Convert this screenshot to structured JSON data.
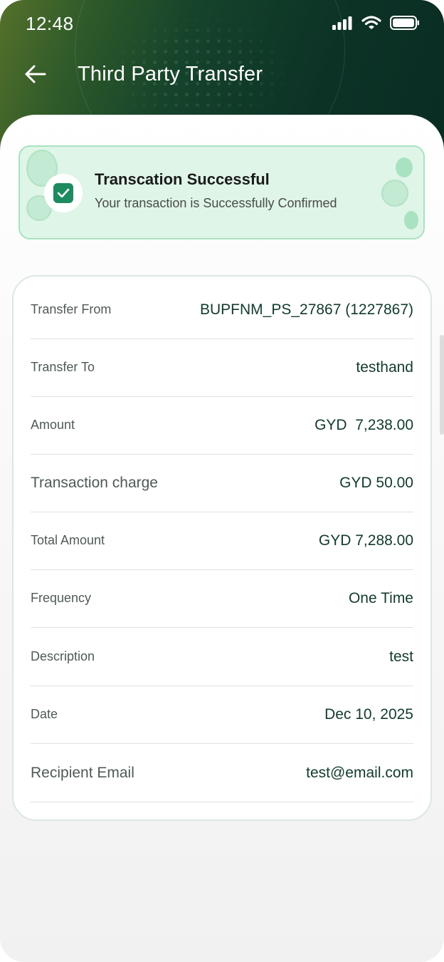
{
  "status_bar": {
    "time": "12:48",
    "icons": [
      "signal-icon",
      "wifi-icon",
      "battery-icon"
    ]
  },
  "nav": {
    "back_icon": "arrow-left-icon",
    "title": "Third Party Transfer"
  },
  "banner": {
    "title": "Transcation Successful",
    "subtitle": "Your transaction is Successfully Confirmed",
    "icon": "checkbox-checked-icon"
  },
  "details": [
    {
      "label": "Transfer From",
      "value": "BUPFNM_PS_27867 (1227867)"
    },
    {
      "label": "Transfer To",
      "value": "testhand"
    },
    {
      "label": "Amount",
      "value": "GYD  7,238.00"
    },
    {
      "label": "Transaction charge",
      "value": "GYD 50.00"
    },
    {
      "label": "Total Amount",
      "value": "GYD 7,288.00"
    },
    {
      "label": "Frequency",
      "value": "One Time"
    },
    {
      "label": "Description",
      "value": "test"
    },
    {
      "label": "Date",
      "value": "Dec 10, 2025"
    },
    {
      "label": "Recipient Email",
      "value": "test@email.com"
    }
  ],
  "colors": {
    "header_dark": "#0c3226",
    "header_light": "#55712a",
    "success_bg": "#dff5e8",
    "success_border": "#a9e2c0",
    "check_green": "#1d8a5f",
    "value_text": "#123a2e"
  }
}
